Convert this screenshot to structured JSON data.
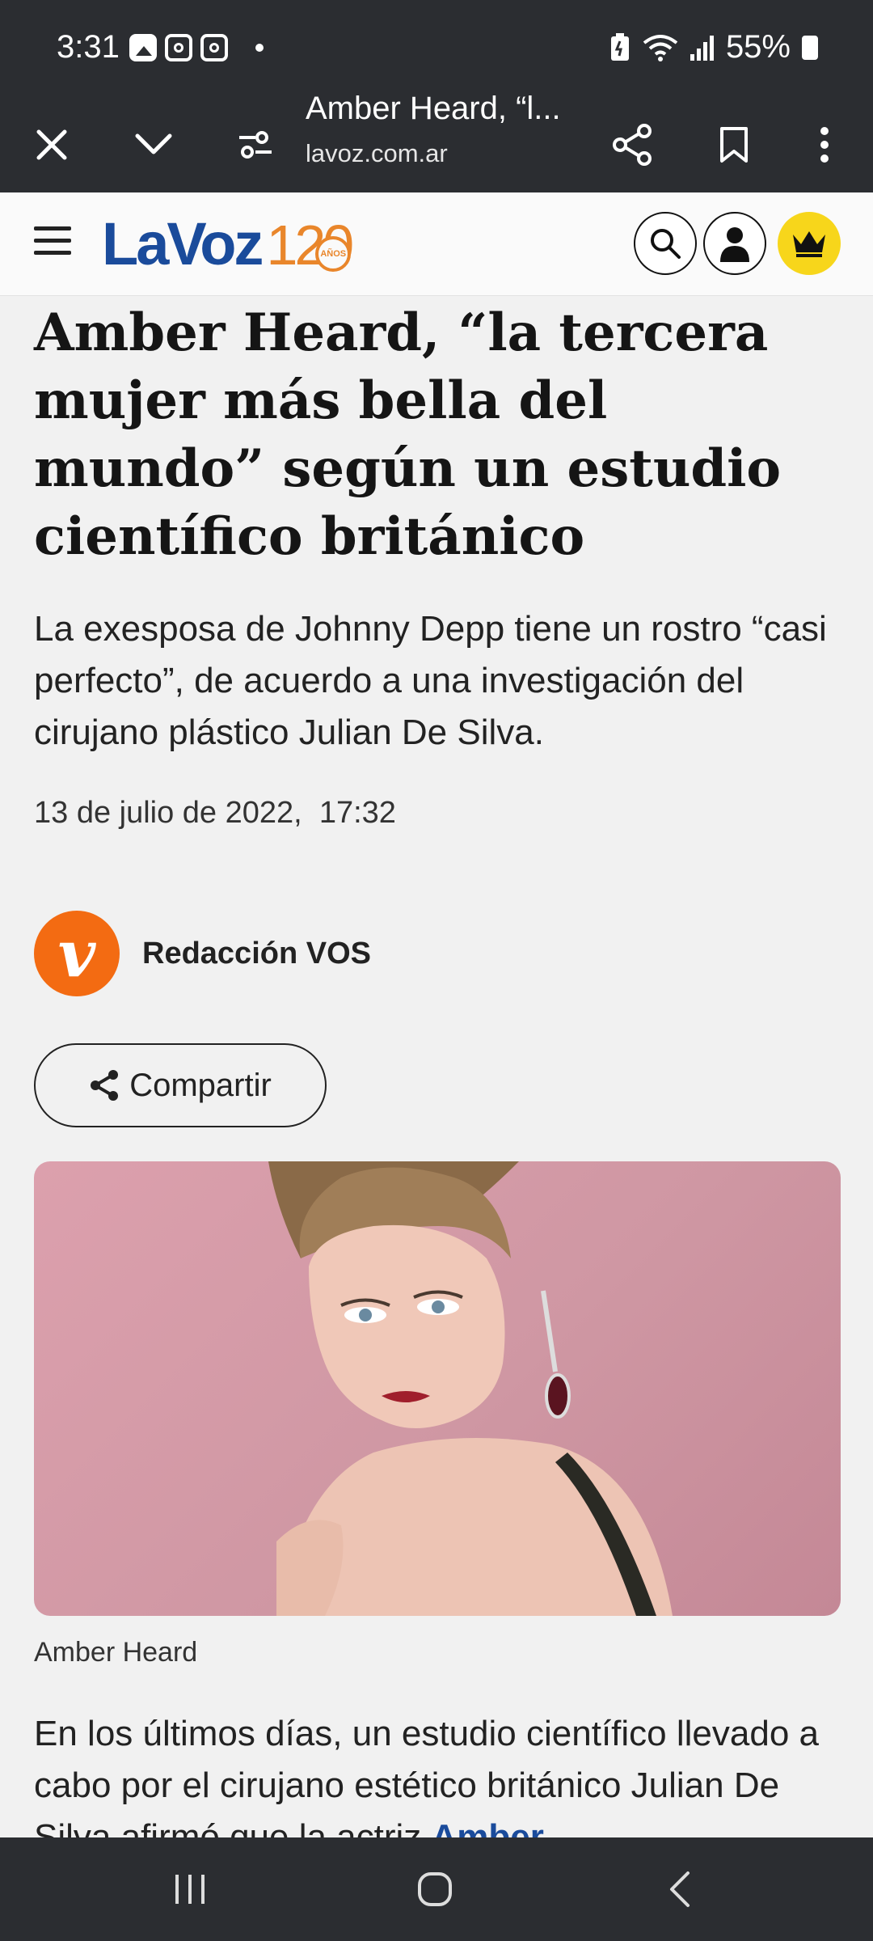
{
  "status_bar": {
    "time": "3:31",
    "battery": "55%"
  },
  "browser": {
    "tab_title": "Amber Heard, “l...",
    "url": "lavoz.com.ar"
  },
  "site": {
    "logo_text": "LaVoz",
    "logo_number": "120",
    "logo_anos": "AÑOS",
    "brand_color": "#1a4b9b",
    "accent_color": "#e9862b",
    "premium_color": "#f7d61b"
  },
  "article": {
    "headline": "Amber Heard, “la tercera mujer más bella del mundo” según un estudio científico británico",
    "subtitle": "La exesposa de Johnny Depp tiene un rostro “casi perfecto”, de acuerdo a una investigación del cirujano plástico Julian De Silva.",
    "date": "13 de julio de 2022,  17:32",
    "author_initial": "v",
    "author_name": "Redacción VOS",
    "share_label": "Compartir",
    "image_caption": "Amber Heard",
    "body_text": "En los últimos días, un estudio científico llevado a cabo por el cirujano estético británico Julian De Silva afirmó que la actriz ",
    "body_link": "Amber"
  }
}
